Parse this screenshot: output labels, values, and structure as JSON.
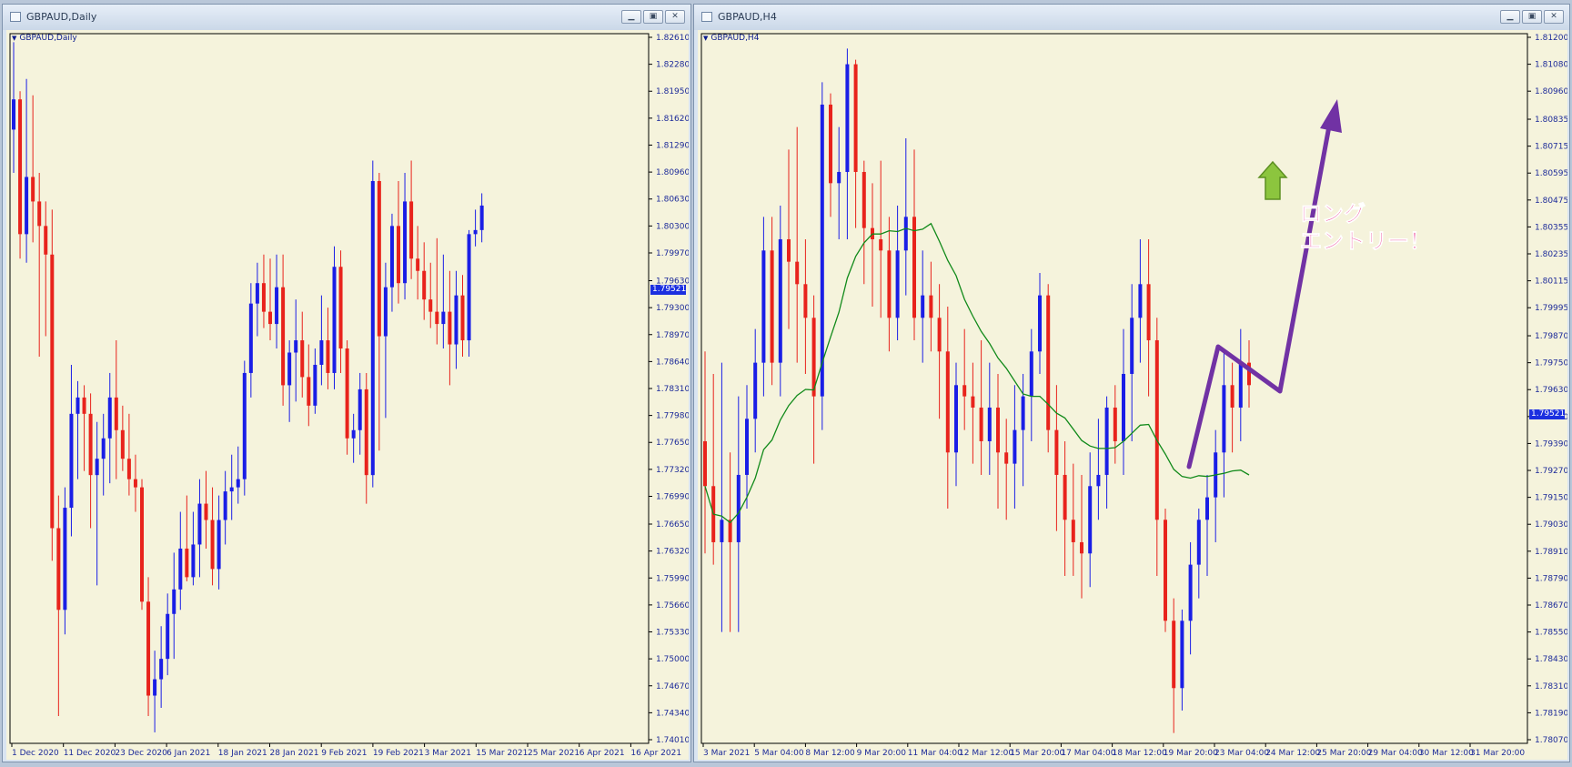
{
  "windows": {
    "left": {
      "title": "GBPAUD,Daily",
      "symbol_label": "GBPAUD,Daily",
      "current_price": "1.79521",
      "buttons": [
        "minimize",
        "restore",
        "close"
      ]
    },
    "right": {
      "title": "GBPAUD,H4",
      "symbol_label": "GBPAUD,H4",
      "current_price": "1.79521",
      "annotation": {
        "line1": "ロング",
        "line2": "エントリー！"
      },
      "buttons": [
        "minimize",
        "restore",
        "close"
      ]
    }
  },
  "colors": {
    "chart_bg": "#f5f3dc",
    "bull": "#1a1ee6",
    "bear": "#e8231c",
    "ma_line": "#118a1a",
    "axis_text": "#1c2a99",
    "arrow": "#7132a4",
    "up_arrow_fill": "#8cc53e",
    "annotation_text": "#e8237f"
  },
  "icons": {
    "window": "chart-window-icon",
    "minimize": "minimize-icon",
    "restore": "restore-icon",
    "close": "close-icon",
    "up_arrow": "up-arrow-icon"
  },
  "chart_data": [
    {
      "type": "candlestick",
      "symbol": "GBPAUD",
      "timeframe": "Daily",
      "y_ticks": [
        "1.82610",
        "1.82280",
        "1.81950",
        "1.81620",
        "1.81290",
        "1.80960",
        "1.80630",
        "1.80300",
        "1.79970",
        "1.79630",
        "1.79300",
        "1.78970",
        "1.78640",
        "1.78310",
        "1.77980",
        "1.77650",
        "1.77320",
        "1.76990",
        "1.76650",
        "1.76320",
        "1.75990",
        "1.75660",
        "1.75330",
        "1.75000",
        "1.74670",
        "1.74340",
        "1.74010"
      ],
      "ylim": [
        1.7401,
        1.8261
      ],
      "x_ticks": [
        "1 Dec 2020",
        "11 Dec 2020",
        "23 Dec 2020",
        "6 Jan 2021",
        "18 Jan 2021",
        "28 Jan 2021",
        "9 Feb 2021",
        "19 Feb 2021",
        "3 Mar 2021",
        "15 Mar 2021",
        "25 Mar 2021",
        "6 Apr 2021",
        "16 Apr 2021"
      ],
      "current_price": 1.79521,
      "candles": [
        {
          "o": 1.8148,
          "h": 1.8255,
          "l": 1.8095,
          "c": 1.8185
        },
        {
          "o": 1.8185,
          "h": 1.8195,
          "l": 1.799,
          "c": 1.802
        },
        {
          "o": 1.802,
          "h": 1.821,
          "l": 1.7985,
          "c": 1.809
        },
        {
          "o": 1.809,
          "h": 1.819,
          "l": 1.801,
          "c": 1.806
        },
        {
          "o": 1.806,
          "h": 1.8095,
          "l": 1.787,
          "c": 1.803
        },
        {
          "o": 1.803,
          "h": 1.806,
          "l": 1.7895,
          "c": 1.7995
        },
        {
          "o": 1.7995,
          "h": 1.805,
          "l": 1.762,
          "c": 1.766
        },
        {
          "o": 1.766,
          "h": 1.77,
          "l": 1.743,
          "c": 1.756
        },
        {
          "o": 1.756,
          "h": 1.771,
          "l": 1.753,
          "c": 1.7685
        },
        {
          "o": 1.7685,
          "h": 1.786,
          "l": 1.765,
          "c": 1.78
        },
        {
          "o": 1.78,
          "h": 1.784,
          "l": 1.772,
          "c": 1.782
        },
        {
          "o": 1.782,
          "h": 1.7835,
          "l": 1.773,
          "c": 1.78
        },
        {
          "o": 1.78,
          "h": 1.7825,
          "l": 1.766,
          "c": 1.7725
        },
        {
          "o": 1.7725,
          "h": 1.779,
          "l": 1.759,
          "c": 1.7745
        },
        {
          "o": 1.7745,
          "h": 1.78,
          "l": 1.77,
          "c": 1.777
        },
        {
          "o": 1.777,
          "h": 1.785,
          "l": 1.7715,
          "c": 1.782
        },
        {
          "o": 1.782,
          "h": 1.789,
          "l": 1.772,
          "c": 1.778
        },
        {
          "o": 1.778,
          "h": 1.781,
          "l": 1.773,
          "c": 1.7745
        },
        {
          "o": 1.7745,
          "h": 1.78,
          "l": 1.77,
          "c": 1.772
        },
        {
          "o": 1.772,
          "h": 1.775,
          "l": 1.768,
          "c": 1.771
        },
        {
          "o": 1.771,
          "h": 1.772,
          "l": 1.756,
          "c": 1.757
        },
        {
          "o": 1.757,
          "h": 1.76,
          "l": 1.743,
          "c": 1.7455
        },
        {
          "o": 1.7455,
          "h": 1.751,
          "l": 1.741,
          "c": 1.7475
        },
        {
          "o": 1.7475,
          "h": 1.754,
          "l": 1.744,
          "c": 1.75
        },
        {
          "o": 1.75,
          "h": 1.758,
          "l": 1.748,
          "c": 1.7555
        },
        {
          "o": 1.7555,
          "h": 1.763,
          "l": 1.75,
          "c": 1.7585
        },
        {
          "o": 1.7585,
          "h": 1.768,
          "l": 1.756,
          "c": 1.7635
        },
        {
          "o": 1.7635,
          "h": 1.77,
          "l": 1.7595,
          "c": 1.76
        },
        {
          "o": 1.76,
          "h": 1.768,
          "l": 1.759,
          "c": 1.764
        },
        {
          "o": 1.764,
          "h": 1.772,
          "l": 1.76,
          "c": 1.769
        },
        {
          "o": 1.769,
          "h": 1.773,
          "l": 1.7635,
          "c": 1.767
        },
        {
          "o": 1.767,
          "h": 1.771,
          "l": 1.759,
          "c": 1.761
        },
        {
          "o": 1.761,
          "h": 1.77,
          "l": 1.7585,
          "c": 1.767
        },
        {
          "o": 1.767,
          "h": 1.773,
          "l": 1.764,
          "c": 1.7705
        },
        {
          "o": 1.7705,
          "h": 1.775,
          "l": 1.767,
          "c": 1.771
        },
        {
          "o": 1.771,
          "h": 1.776,
          "l": 1.769,
          "c": 1.772
        },
        {
          "o": 1.772,
          "h": 1.7865,
          "l": 1.77,
          "c": 1.785
        },
        {
          "o": 1.785,
          "h": 1.796,
          "l": 1.782,
          "c": 1.7935
        },
        {
          "o": 1.7935,
          "h": 1.7985,
          "l": 1.7895,
          "c": 1.796
        },
        {
          "o": 1.796,
          "h": 1.7995,
          "l": 1.7905,
          "c": 1.7925
        },
        {
          "o": 1.7925,
          "h": 1.799,
          "l": 1.789,
          "c": 1.791
        },
        {
          "o": 1.791,
          "h": 1.7995,
          "l": 1.788,
          "c": 1.7955
        },
        {
          "o": 1.7955,
          "h": 1.7995,
          "l": 1.781,
          "c": 1.7835
        },
        {
          "o": 1.7835,
          "h": 1.789,
          "l": 1.779,
          "c": 1.7875
        },
        {
          "o": 1.7875,
          "h": 1.794,
          "l": 1.7815,
          "c": 1.789
        },
        {
          "o": 1.789,
          "h": 1.7925,
          "l": 1.782,
          "c": 1.7845
        },
        {
          "o": 1.7845,
          "h": 1.7885,
          "l": 1.7785,
          "c": 1.781
        },
        {
          "o": 1.781,
          "h": 1.788,
          "l": 1.78,
          "c": 1.786
        },
        {
          "o": 1.786,
          "h": 1.7945,
          "l": 1.7835,
          "c": 1.789
        },
        {
          "o": 1.789,
          "h": 1.793,
          "l": 1.783,
          "c": 1.785
        },
        {
          "o": 1.785,
          "h": 1.8005,
          "l": 1.783,
          "c": 1.798
        },
        {
          "o": 1.798,
          "h": 1.8,
          "l": 1.785,
          "c": 1.788
        },
        {
          "o": 1.788,
          "h": 1.789,
          "l": 1.775,
          "c": 1.777
        },
        {
          "o": 1.777,
          "h": 1.78,
          "l": 1.774,
          "c": 1.778
        },
        {
          "o": 1.778,
          "h": 1.785,
          "l": 1.775,
          "c": 1.783
        },
        {
          "o": 1.783,
          "h": 1.785,
          "l": 1.769,
          "c": 1.7725
        },
        {
          "o": 1.7725,
          "h": 1.811,
          "l": 1.771,
          "c": 1.8085
        },
        {
          "o": 1.8085,
          "h": 1.8095,
          "l": 1.7755,
          "c": 1.7895
        },
        {
          "o": 1.7895,
          "h": 1.7985,
          "l": 1.7795,
          "c": 1.7955
        },
        {
          "o": 1.7955,
          "h": 1.8045,
          "l": 1.7925,
          "c": 1.803
        },
        {
          "o": 1.803,
          "h": 1.8085,
          "l": 1.7935,
          "c": 1.796
        },
        {
          "o": 1.796,
          "h": 1.8095,
          "l": 1.794,
          "c": 1.806
        },
        {
          "o": 1.806,
          "h": 1.811,
          "l": 1.7965,
          "c": 1.799
        },
        {
          "o": 1.799,
          "h": 1.803,
          "l": 1.794,
          "c": 1.7975
        },
        {
          "o": 1.7975,
          "h": 1.801,
          "l": 1.7915,
          "c": 1.794
        },
        {
          "o": 1.794,
          "h": 1.7985,
          "l": 1.7905,
          "c": 1.7925
        },
        {
          "o": 1.7925,
          "h": 1.8015,
          "l": 1.7885,
          "c": 1.791
        },
        {
          "o": 1.791,
          "h": 1.7995,
          "l": 1.788,
          "c": 1.7925
        },
        {
          "o": 1.7925,
          "h": 1.7975,
          "l": 1.7835,
          "c": 1.7885
        },
        {
          "o": 1.7885,
          "h": 1.7975,
          "l": 1.7855,
          "c": 1.7945
        },
        {
          "o": 1.7945,
          "h": 1.797,
          "l": 1.787,
          "c": 1.789
        },
        {
          "o": 1.789,
          "h": 1.8025,
          "l": 1.787,
          "c": 1.802
        },
        {
          "o": 1.802,
          "h": 1.805,
          "l": 1.8005,
          "c": 1.8025
        },
        {
          "o": 1.8025,
          "h": 1.807,
          "l": 1.801,
          "c": 1.8055
        }
      ]
    },
    {
      "type": "candlestick",
      "symbol": "GBPAUD",
      "timeframe": "H4",
      "y_ticks": [
        "1.81200",
        "1.81080",
        "1.80960",
        "1.80835",
        "1.80715",
        "1.80595",
        "1.80475",
        "1.80355",
        "1.80235",
        "1.80115",
        "1.79995",
        "1.79870",
        "1.79750",
        "1.79630",
        "1.79510",
        "1.79390",
        "1.79270",
        "1.79150",
        "1.79030",
        "1.78910",
        "1.78790",
        "1.78670",
        "1.78550",
        "1.78430",
        "1.78310",
        "1.78190",
        "1.78070"
      ],
      "ylim": [
        1.7807,
        1.812
      ],
      "x_ticks": [
        "3 Mar 2021",
        "5 Mar 04:00",
        "8 Mar 12:00",
        "9 Mar 20:00",
        "11 Mar 04:00",
        "12 Mar 12:00",
        "15 Mar 20:00",
        "17 Mar 04:00",
        "18 Mar 12:00",
        "19 Mar 20:00",
        "23 Mar 04:00",
        "24 Mar 12:00",
        "25 Mar 20:00",
        "29 Mar 04:00",
        "30 Mar 12:00",
        "31 Mar 20:00"
      ],
      "current_price": 1.79521,
      "candles": [
        {
          "o": 1.794,
          "h": 1.798,
          "l": 1.789,
          "c": 1.792
        },
        {
          "o": 1.792,
          "h": 1.797,
          "l": 1.7885,
          "c": 1.7895
        },
        {
          "o": 1.7895,
          "h": 1.7975,
          "l": 1.7855,
          "c": 1.7905
        },
        {
          "o": 1.7905,
          "h": 1.7935,
          "l": 1.7855,
          "c": 1.7895
        },
        {
          "o": 1.7895,
          "h": 1.796,
          "l": 1.7855,
          "c": 1.7925
        },
        {
          "o": 1.7925,
          "h": 1.7965,
          "l": 1.791,
          "c": 1.795
        },
        {
          "o": 1.795,
          "h": 1.799,
          "l": 1.7935,
          "c": 1.7975
        },
        {
          "o": 1.7975,
          "h": 1.804,
          "l": 1.796,
          "c": 1.8025
        },
        {
          "o": 1.8025,
          "h": 1.804,
          "l": 1.7965,
          "c": 1.7975
        },
        {
          "o": 1.7975,
          "h": 1.8045,
          "l": 1.796,
          "c": 1.803
        },
        {
          "o": 1.803,
          "h": 1.807,
          "l": 1.799,
          "c": 1.802
        },
        {
          "o": 1.802,
          "h": 1.808,
          "l": 1.7975,
          "c": 1.801
        },
        {
          "o": 1.801,
          "h": 1.803,
          "l": 1.797,
          "c": 1.7995
        },
        {
          "o": 1.7995,
          "h": 1.8005,
          "l": 1.793,
          "c": 1.796
        },
        {
          "o": 1.796,
          "h": 1.81,
          "l": 1.7945,
          "c": 1.809
        },
        {
          "o": 1.809,
          "h": 1.8095,
          "l": 1.804,
          "c": 1.8055
        },
        {
          "o": 1.8055,
          "h": 1.808,
          "l": 1.803,
          "c": 1.806
        },
        {
          "o": 1.806,
          "h": 1.8115,
          "l": 1.803,
          "c": 1.8108
        },
        {
          "o": 1.8108,
          "h": 1.811,
          "l": 1.8035,
          "c": 1.806
        },
        {
          "o": 1.806,
          "h": 1.8065,
          "l": 1.801,
          "c": 1.8035
        },
        {
          "o": 1.8035,
          "h": 1.8055,
          "l": 1.8,
          "c": 1.803
        },
        {
          "o": 1.803,
          "h": 1.8065,
          "l": 1.7995,
          "c": 1.8025
        },
        {
          "o": 1.8025,
          "h": 1.804,
          "l": 1.798,
          "c": 1.7995
        },
        {
          "o": 1.7995,
          "h": 1.8045,
          "l": 1.7985,
          "c": 1.8025
        },
        {
          "o": 1.8025,
          "h": 1.8075,
          "l": 1.8005,
          "c": 1.804
        },
        {
          "o": 1.804,
          "h": 1.807,
          "l": 1.7985,
          "c": 1.7995
        },
        {
          "o": 1.7995,
          "h": 1.8025,
          "l": 1.7975,
          "c": 1.8005
        },
        {
          "o": 1.8005,
          "h": 1.802,
          "l": 1.798,
          "c": 1.7995
        },
        {
          "o": 1.7995,
          "h": 1.801,
          "l": 1.795,
          "c": 1.798
        },
        {
          "o": 1.798,
          "h": 1.8,
          "l": 1.791,
          "c": 1.7935
        },
        {
          "o": 1.7935,
          "h": 1.7975,
          "l": 1.792,
          "c": 1.7965
        },
        {
          "o": 1.7965,
          "h": 1.799,
          "l": 1.7945,
          "c": 1.796
        },
        {
          "o": 1.796,
          "h": 1.7975,
          "l": 1.793,
          "c": 1.7955
        },
        {
          "o": 1.7955,
          "h": 1.7985,
          "l": 1.7925,
          "c": 1.794
        },
        {
          "o": 1.794,
          "h": 1.7975,
          "l": 1.7925,
          "c": 1.7955
        },
        {
          "o": 1.7955,
          "h": 1.797,
          "l": 1.791,
          "c": 1.7935
        },
        {
          "o": 1.7935,
          "h": 1.795,
          "l": 1.7905,
          "c": 1.793
        },
        {
          "o": 1.793,
          "h": 1.7965,
          "l": 1.791,
          "c": 1.7945
        },
        {
          "o": 1.7945,
          "h": 1.797,
          "l": 1.792,
          "c": 1.796
        },
        {
          "o": 1.796,
          "h": 1.799,
          "l": 1.794,
          "c": 1.798
        },
        {
          "o": 1.798,
          "h": 1.8015,
          "l": 1.797,
          "c": 1.8005
        },
        {
          "o": 1.8005,
          "h": 1.801,
          "l": 1.7935,
          "c": 1.7945
        },
        {
          "o": 1.7945,
          "h": 1.7965,
          "l": 1.79,
          "c": 1.7925
        },
        {
          "o": 1.7925,
          "h": 1.794,
          "l": 1.788,
          "c": 1.7905
        },
        {
          "o": 1.7905,
          "h": 1.793,
          "l": 1.788,
          "c": 1.7895
        },
        {
          "o": 1.7895,
          "h": 1.7925,
          "l": 1.787,
          "c": 1.789
        },
        {
          "o": 1.789,
          "h": 1.7935,
          "l": 1.7875,
          "c": 1.792
        },
        {
          "o": 1.792,
          "h": 1.795,
          "l": 1.7905,
          "c": 1.7925
        },
        {
          "o": 1.7925,
          "h": 1.796,
          "l": 1.791,
          "c": 1.7955
        },
        {
          "o": 1.7955,
          "h": 1.7965,
          "l": 1.793,
          "c": 1.794
        },
        {
          "o": 1.794,
          "h": 1.799,
          "l": 1.7925,
          "c": 1.797
        },
        {
          "o": 1.797,
          "h": 1.801,
          "l": 1.794,
          "c": 1.7995
        },
        {
          "o": 1.7995,
          "h": 1.803,
          "l": 1.7975,
          "c": 1.801
        },
        {
          "o": 1.801,
          "h": 1.803,
          "l": 1.796,
          "c": 1.7985
        },
        {
          "o": 1.7985,
          "h": 1.7995,
          "l": 1.788,
          "c": 1.7905
        },
        {
          "o": 1.7905,
          "h": 1.791,
          "l": 1.7855,
          "c": 1.786
        },
        {
          "o": 1.786,
          "h": 1.787,
          "l": 1.781,
          "c": 1.783
        },
        {
          "o": 1.783,
          "h": 1.7865,
          "l": 1.782,
          "c": 1.786
        },
        {
          "o": 1.786,
          "h": 1.7895,
          "l": 1.7845,
          "c": 1.7885
        },
        {
          "o": 1.7885,
          "h": 1.791,
          "l": 1.787,
          "c": 1.7905
        },
        {
          "o": 1.7905,
          "h": 1.7925,
          "l": 1.788,
          "c": 1.7915
        },
        {
          "o": 1.7915,
          "h": 1.7945,
          "l": 1.7895,
          "c": 1.7935
        },
        {
          "o": 1.7935,
          "h": 1.798,
          "l": 1.7915,
          "c": 1.7965
        },
        {
          "o": 1.7965,
          "h": 1.7975,
          "l": 1.7935,
          "c": 1.7955
        },
        {
          "o": 1.7955,
          "h": 1.799,
          "l": 1.794,
          "c": 1.7975
        },
        {
          "o": 1.7975,
          "h": 1.7985,
          "l": 1.7955,
          "c": 1.7965
        }
      ]
    }
  ]
}
